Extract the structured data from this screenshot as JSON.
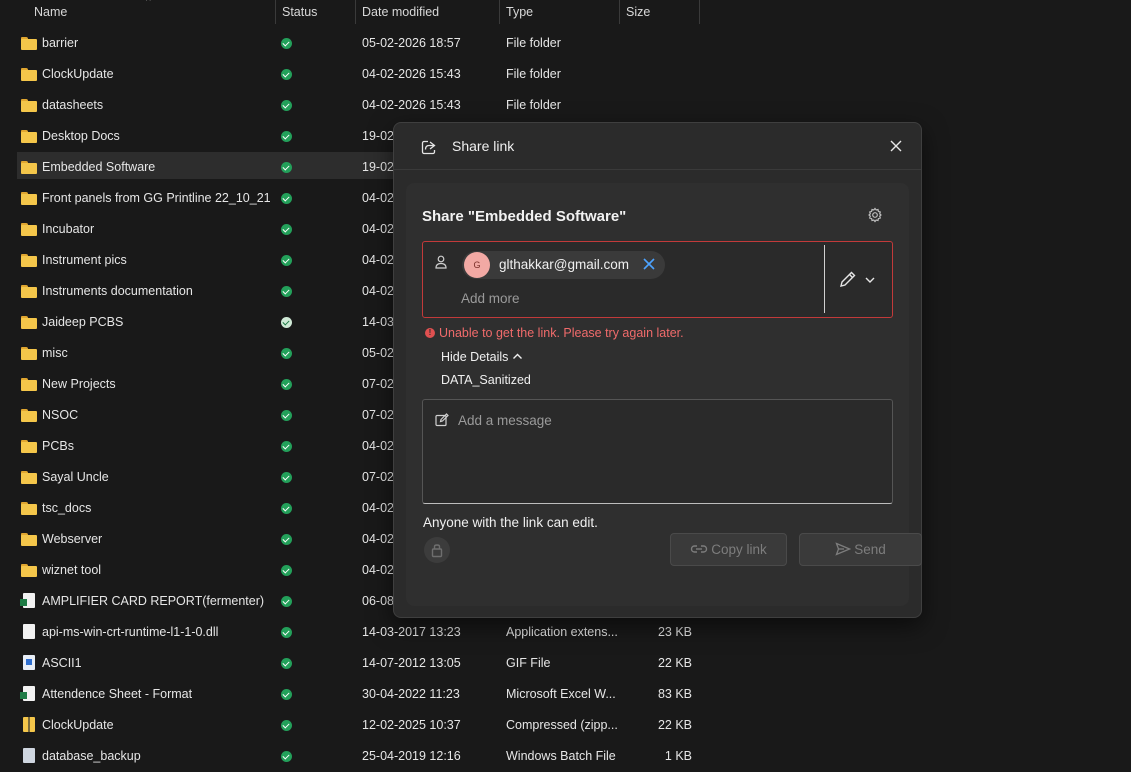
{
  "columns": {
    "name": "Name",
    "status": "Status",
    "date": "Date modified",
    "type": "Type",
    "size": "Size"
  },
  "files": [
    {
      "icon": "folder-icon",
      "name": "barrier",
      "status": "synced",
      "date": "05-02-2026 18:57",
      "type": "File folder",
      "size": ""
    },
    {
      "icon": "folder-icon",
      "name": "ClockUpdate",
      "status": "synced",
      "date": "04-02-2026 15:43",
      "type": "File folder",
      "size": ""
    },
    {
      "icon": "folder-icon",
      "name": "datasheets",
      "status": "synced",
      "date": "04-02-2026 15:43",
      "type": "File folder",
      "size": ""
    },
    {
      "icon": "folder-icon",
      "name": "Desktop Docs",
      "status": "synced",
      "date": "19-02-",
      "type": "",
      "size": ""
    },
    {
      "icon": "folder-icon",
      "name": "Embedded Software",
      "status": "synced",
      "date": "19-02-",
      "type": "",
      "size": "",
      "selected": true
    },
    {
      "icon": "folder-icon",
      "name": "Front panels from GG Printline 22_10_21",
      "status": "synced",
      "date": "04-02-",
      "type": "",
      "size": ""
    },
    {
      "icon": "folder-icon",
      "name": "Incubator",
      "status": "synced",
      "date": "04-02-",
      "type": "",
      "size": ""
    },
    {
      "icon": "folder-icon",
      "name": "Instrument pics",
      "status": "synced",
      "date": "04-02-",
      "type": "",
      "size": ""
    },
    {
      "icon": "folder-icon",
      "name": "Instruments documentation",
      "status": "synced",
      "date": "04-02-",
      "type": "",
      "size": ""
    },
    {
      "icon": "folder-icon",
      "name": "Jaideep PCBS",
      "status": "available",
      "date": "14-03-",
      "type": "",
      "size": ""
    },
    {
      "icon": "folder-icon",
      "name": "misc",
      "status": "synced",
      "date": "05-02-",
      "type": "",
      "size": ""
    },
    {
      "icon": "folder-icon",
      "name": "New Projects",
      "status": "synced",
      "date": "07-02-",
      "type": "",
      "size": ""
    },
    {
      "icon": "folder-icon",
      "name": "NSOC",
      "status": "synced",
      "date": "07-02-",
      "type": "",
      "size": ""
    },
    {
      "icon": "folder-icon",
      "name": "PCBs",
      "status": "synced",
      "date": "04-02-",
      "type": "",
      "size": ""
    },
    {
      "icon": "folder-icon",
      "name": "Sayal Uncle",
      "status": "synced",
      "date": "07-02-",
      "type": "",
      "size": ""
    },
    {
      "icon": "folder-icon",
      "name": "tsc_docs",
      "status": "synced",
      "date": "04-02-",
      "type": "",
      "size": ""
    },
    {
      "icon": "folder-icon",
      "name": "Webserver",
      "status": "synced",
      "date": "04-02-",
      "type": "",
      "size": ""
    },
    {
      "icon": "folder-icon",
      "name": "wiznet tool",
      "status": "synced",
      "date": "04-02-",
      "type": "",
      "size": ""
    },
    {
      "icon": "excel-file-icon",
      "name": "AMPLIFIER CARD REPORT(fermenter)",
      "status": "synced",
      "date": "06-08-",
      "type": "",
      "size": ""
    },
    {
      "icon": "dll-file-icon",
      "name": "api-ms-win-crt-runtime-l1-1-0.dll",
      "status": "synced",
      "date": "14-03-2017 13:23",
      "type": "Application extens...",
      "size": "23 KB"
    },
    {
      "icon": "gif-file-icon",
      "name": "ASCII1",
      "status": "synced",
      "date": "14-07-2012 13:05",
      "type": "GIF File",
      "size": "22 KB"
    },
    {
      "icon": "excel-file-icon",
      "name": "Attendence Sheet - Format",
      "status": "synced",
      "date": "30-04-2022 11:23",
      "type": "Microsoft Excel W...",
      "size": "83 KB"
    },
    {
      "icon": "zip-file-icon",
      "name": "ClockUpdate",
      "status": "synced",
      "date": "12-02-2025 10:37",
      "type": "Compressed (zipp...",
      "size": "22 KB"
    },
    {
      "icon": "batch-file-icon",
      "name": "database_backup",
      "status": "synced",
      "date": "25-04-2019 12:16",
      "type": "Windows Batch File",
      "size": "1 KB"
    }
  ],
  "dialog": {
    "title": "Share link",
    "heading": "Share \"Embedded Software\"",
    "recipient": {
      "initial": "G",
      "email": "glthakkar@gmail.com"
    },
    "add_more_placeholder": "Add more",
    "error": "Unable to get the link. Please try again later.",
    "hide_details": "Hide Details",
    "detail_value": "DATA_Sanitized",
    "message_placeholder": "Add a message",
    "access_text": "Anyone with the link can edit.",
    "copy_link": "Copy link",
    "send": "Send"
  },
  "colors": {
    "error": "#f06b6b",
    "error_border": "#c23a3a",
    "status_green": "#23a05a",
    "folder": "#f4c64a",
    "avatar": "#f2a9a4"
  }
}
